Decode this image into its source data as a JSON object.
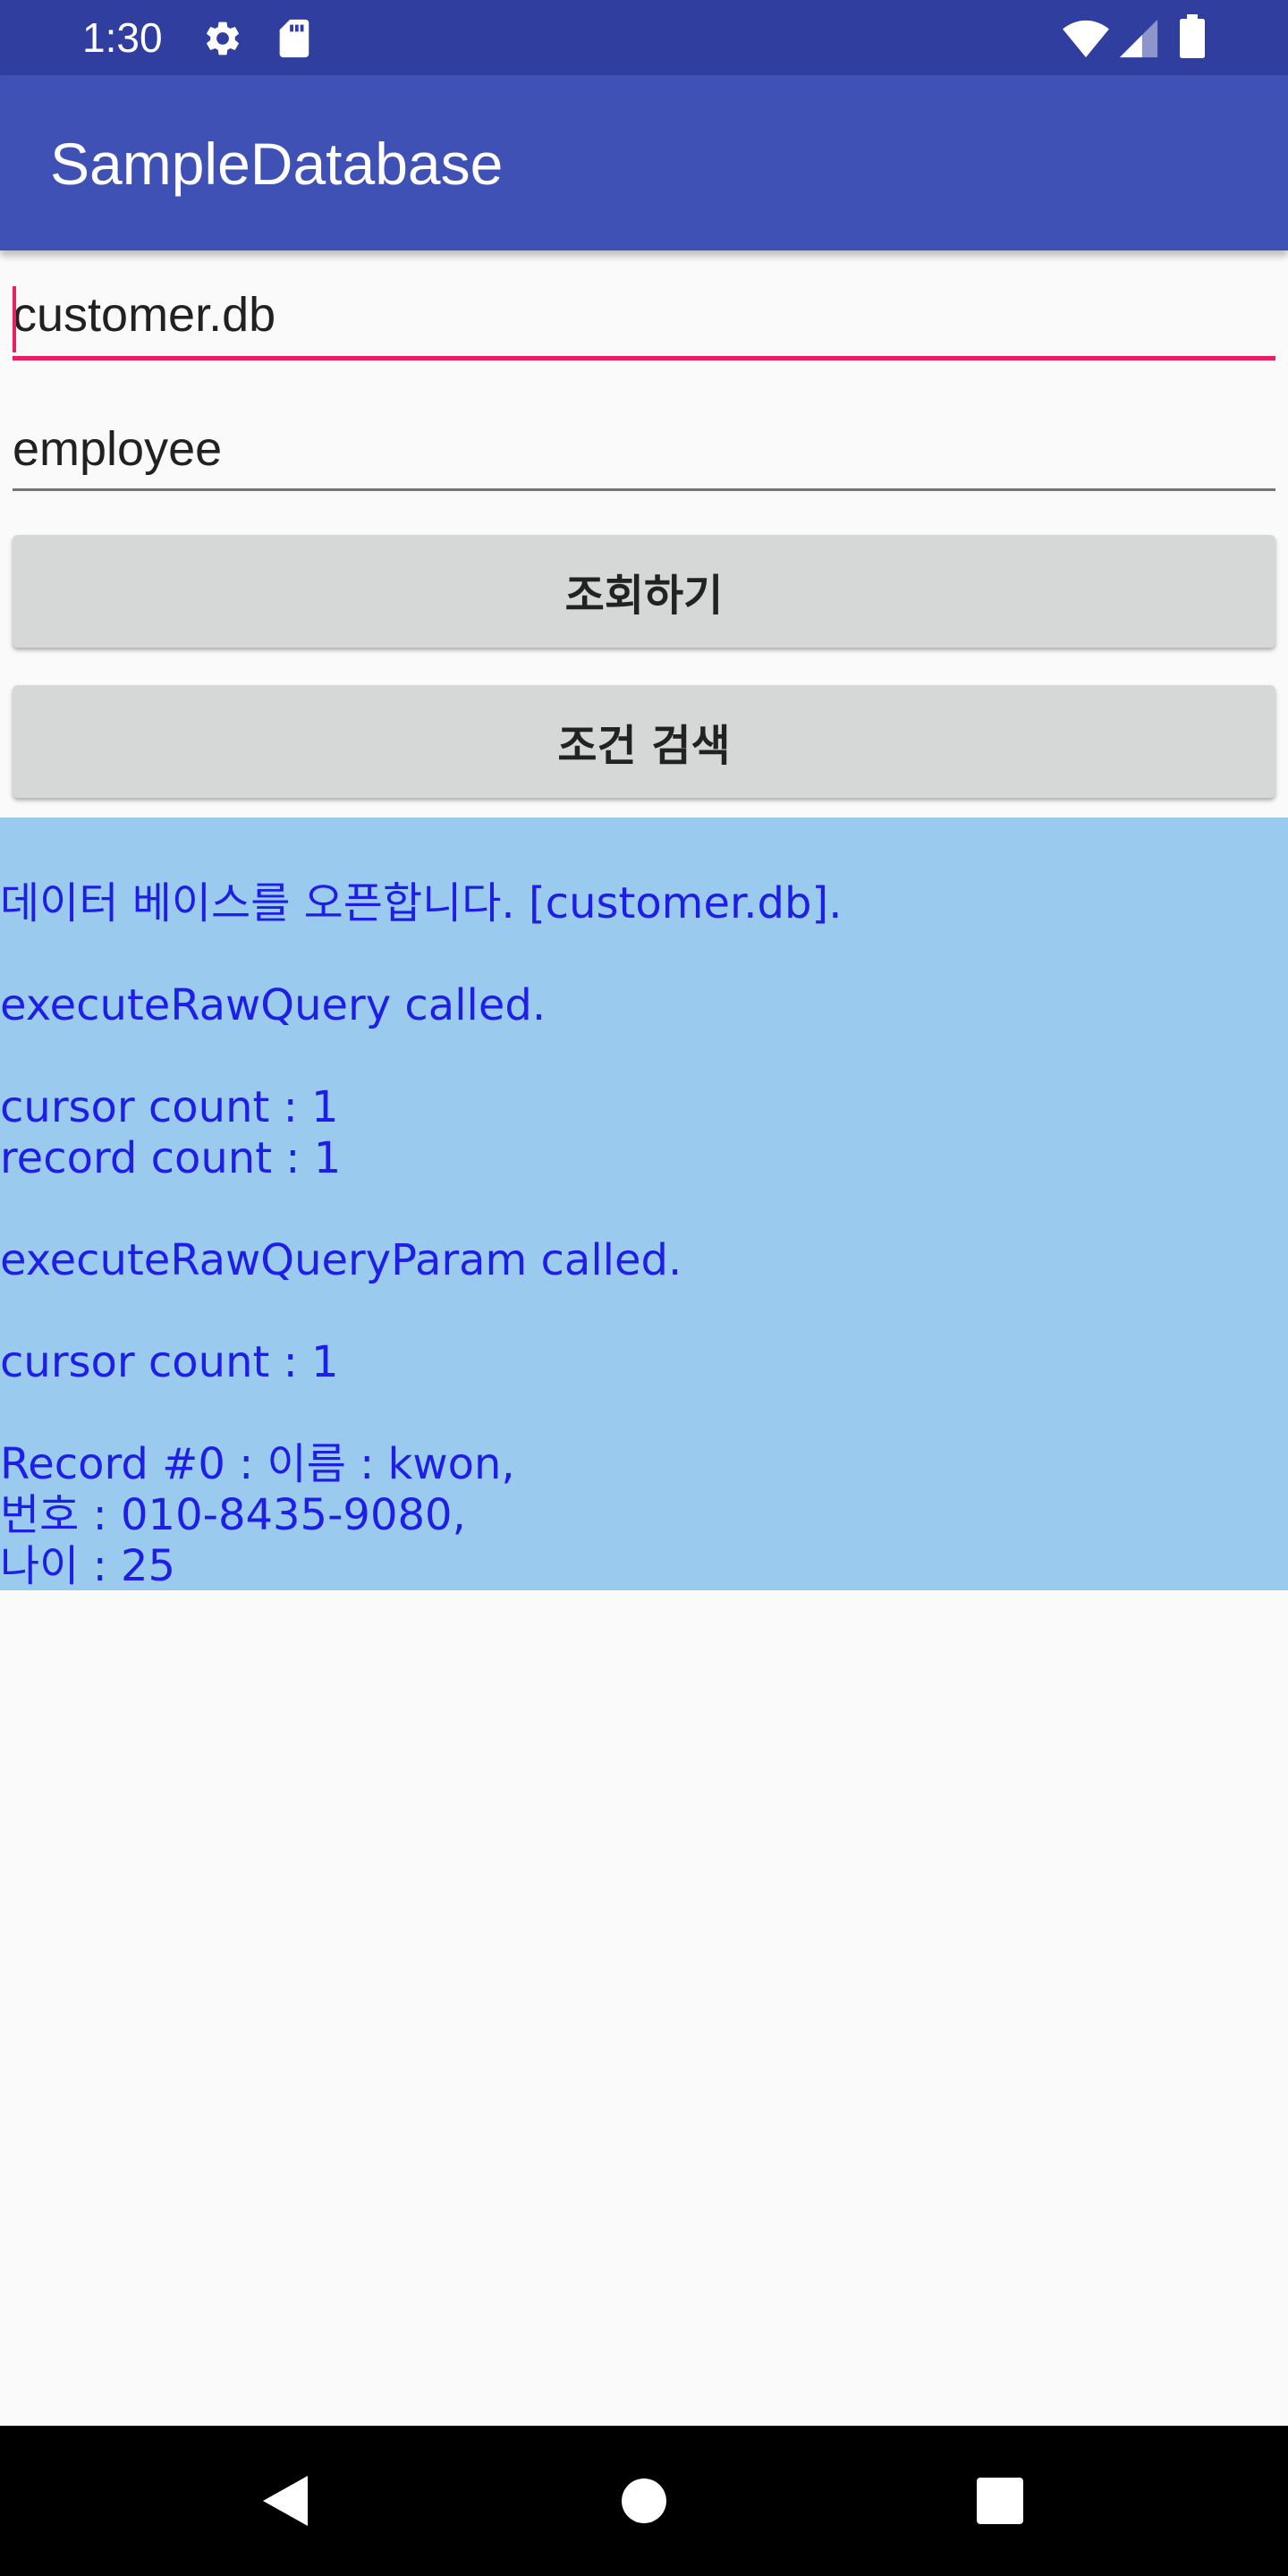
{
  "status_bar": {
    "time": "1:30",
    "icons": [
      "gear-icon",
      "sd-card-icon",
      "wifi-icon",
      "signal-icon",
      "battery-icon"
    ]
  },
  "app_bar": {
    "title": "SampleDatabase"
  },
  "database_field": {
    "value": "customer.db",
    "focused": true
  },
  "table_field": {
    "value": "employee"
  },
  "buttons": {
    "query": "조회하기",
    "search": "조건 검색"
  },
  "output": {
    "lines": [
      "데이터 베이스를 오픈합니다. [customer.db].",
      "",
      "executeRawQuery called.",
      "",
      "cursor count : 1",
      "record count : 1",
      "",
      "executeRawQueryParam called.",
      "",
      "cursor count : 1",
      "",
      "Record #0 : 이름 : kwon,",
      "번호 : 010-8435-9080,",
      "나이 : 25"
    ]
  },
  "nav_bar": {
    "icons": [
      "back-icon",
      "home-icon",
      "recents-icon"
    ]
  },
  "colors": {
    "status_bar": "#303f9f",
    "app_bar": "#3f51b5",
    "accent": "#e91e63",
    "output_background": "#9acbef",
    "output_text": "#1e1ee6",
    "button_background": "#d6d7d7"
  }
}
